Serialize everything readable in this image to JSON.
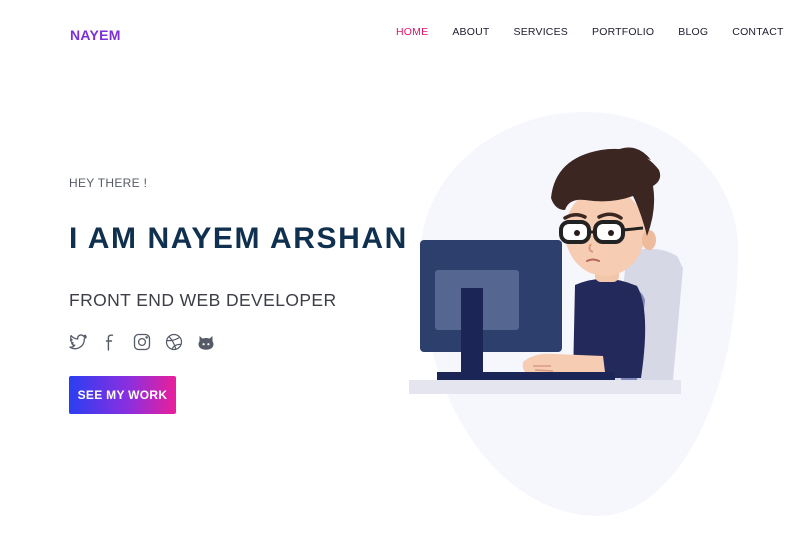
{
  "brand": {
    "logo": "NAYEM",
    "accent": "#7b2fd6",
    "active_nav_color": "#e0156b"
  },
  "nav": {
    "items": [
      {
        "label": "HOME",
        "active": true
      },
      {
        "label": "ABOUT"
      },
      {
        "label": "SERVICES"
      },
      {
        "label": "PORTFOLIO"
      },
      {
        "label": "BLOG"
      },
      {
        "label": "CONTACT"
      }
    ]
  },
  "hero": {
    "greeting": "HEY THERE !",
    "name": "I AM NAYEM ARSHAN",
    "role": "FRONT END WEB DEVELOPER",
    "social_icons": [
      "twitter-icon",
      "facebook-icon",
      "instagram-icon",
      "dribbble-icon",
      "github-icon"
    ],
    "cta_label": "SEE MY WORK",
    "cta_gradient": [
      "#2b3ef2",
      "#8a2fe0",
      "#ea1f9a"
    ]
  },
  "illustration": {
    "subject": "developer-at-computer-illustration"
  }
}
